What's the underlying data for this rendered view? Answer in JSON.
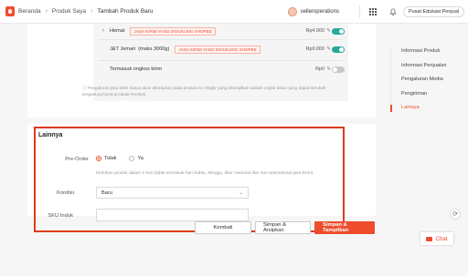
{
  "header": {
    "breadcrumbs": [
      "Beranda",
      "Produk Saya",
      "Tambah Produk Baru"
    ],
    "username": "selleroperations",
    "education_button": "Pusat Edukasi Penjual"
  },
  "shipping": {
    "rows": [
      {
        "chevron": "›",
        "name": "Hemat",
        "tag": "JASA KIRIM YANG DIDUKUNG SHOPEE",
        "price": "Rp4.000",
        "enabled": true
      },
      {
        "chevron": "",
        "name": "J&T Jemari",
        "name_note": "(maks 3000g)",
        "tag": "JASA KIRIM YANG DIDUKUNG SHOPEE",
        "price": "Rp9.000",
        "enabled": true
      },
      {
        "chevron": "",
        "name": "Termasuk ongkos kirim",
        "tag": "",
        "price": "Rp0",
        "enabled": false
      }
    ],
    "note": "Pengaturan jasa kirim hanya akan diterapkan pada produk ini. Ongkir yang ditampilkan adalah ongkir dasar yang dapat berubah tergantung berat & lokasi Pembeli."
  },
  "side_nav": {
    "items": [
      "Informasi Produk",
      "Informasi Penjualan",
      "Pengaturan Media",
      "Pengiriman",
      "Lainnya"
    ],
    "active_index": 4
  },
  "lainnya": {
    "title": "Lainnya",
    "preorder_label": "Pre-Order",
    "preorder_options": [
      "Tidak",
      "Ya"
    ],
    "preorder_selected": "Tidak",
    "helper": "Kirimkan produk dalam 2 hari (tidak termasuk hari Sabtu, Minggu, libur nasional dan non-operasional jasa kirim).",
    "kondisi_label": "Kondisi",
    "kondisi_value": "Baru",
    "sku_label": "SKU Induk",
    "sku_value": "-"
  },
  "footer": {
    "back": "Kembali",
    "save_archive": "Simpan & Arsipkan",
    "save_show": "Simpan & Tampilkan"
  },
  "chat": {
    "label": "Chat"
  },
  "colors": {
    "brand": "#ee4d2d",
    "toggle_on": "#26aa99",
    "highlight_border": "#dc3b1a"
  }
}
